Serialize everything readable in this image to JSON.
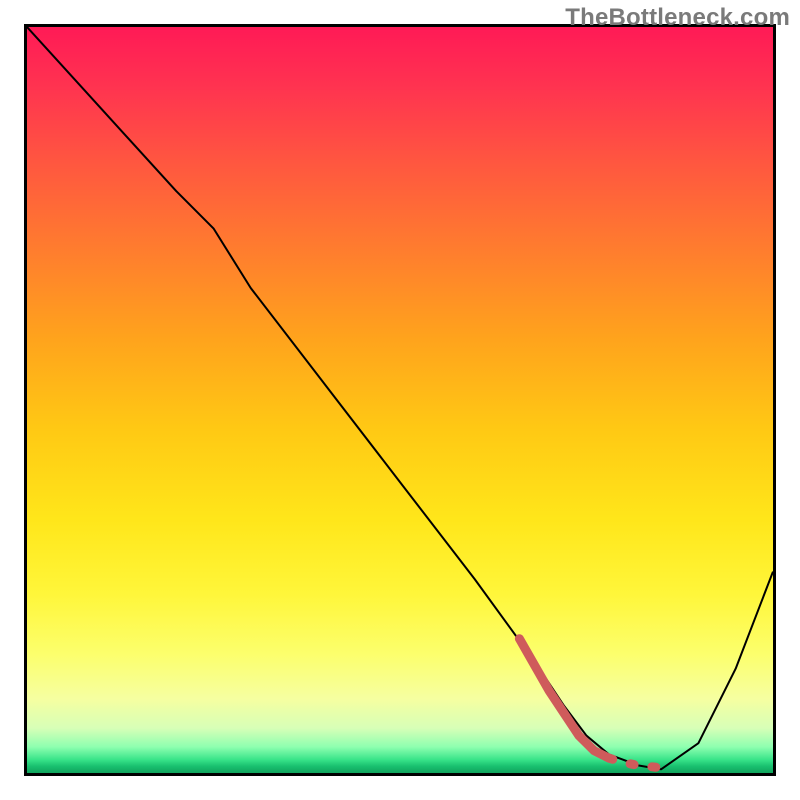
{
  "watermark": "TheBottleneck.com",
  "chart_data": {
    "type": "line",
    "title": "",
    "xlabel": "",
    "ylabel": "",
    "xlim": [
      0,
      100
    ],
    "ylim": [
      0,
      100
    ],
    "grid": false,
    "legend": false,
    "series": [
      {
        "name": "main-curve",
        "color": "#000000",
        "stroke_width": 2,
        "x": [
          0,
          10,
          20,
          25,
          30,
          40,
          50,
          60,
          68,
          72,
          75,
          78,
          82,
          85,
          90,
          95,
          100
        ],
        "y": [
          100,
          89,
          78,
          73,
          65,
          52,
          39,
          26,
          15,
          9,
          5,
          2.5,
          1,
          0.5,
          4,
          14,
          27
        ]
      },
      {
        "name": "highlight-low-region",
        "color": "#cf5b5b",
        "stroke_width": 9,
        "style": "mixed-solid-then-dashed",
        "x": [
          66,
          70,
          74,
          76,
          78,
          80,
          82,
          84,
          86
        ],
        "y": [
          18,
          11,
          5,
          3,
          2,
          1.4,
          1,
          0.8,
          0.6
        ]
      }
    ],
    "background_gradient": {
      "orientation": "vertical",
      "stops": [
        {
          "pos": 0.0,
          "color": "#ff1a56"
        },
        {
          "pos": 0.18,
          "color": "#ff5640"
        },
        {
          "pos": 0.42,
          "color": "#ffa41c"
        },
        {
          "pos": 0.66,
          "color": "#ffe61a"
        },
        {
          "pos": 0.84,
          "color": "#fcff6c"
        },
        {
          "pos": 0.94,
          "color": "#d7ffb7"
        },
        {
          "pos": 0.982,
          "color": "#39e489"
        },
        {
          "pos": 1.0,
          "color": "#11a45d"
        }
      ]
    }
  }
}
